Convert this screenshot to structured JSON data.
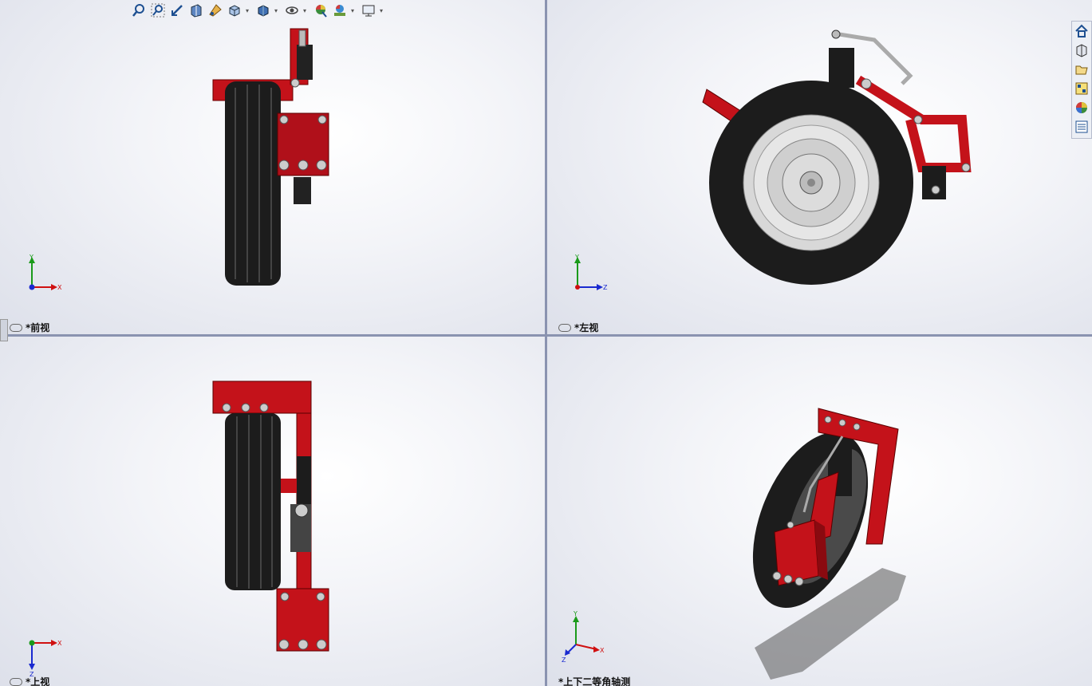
{
  "toolbar": {
    "items": [
      {
        "icon": "zoom-to-fit-icon",
        "dropdown": false
      },
      {
        "icon": "zoom-to-area-icon",
        "dropdown": false
      },
      {
        "icon": "previous-view-icon",
        "dropdown": false
      },
      {
        "icon": "section-view-icon",
        "dropdown": false
      },
      {
        "icon": "dynamic-annotation-icon",
        "dropdown": false
      },
      {
        "icon": "view-orientation-icon",
        "dropdown": true
      },
      {
        "icon": "display-style-icon",
        "dropdown": true
      },
      {
        "icon": "hide-show-items-icon",
        "dropdown": true
      },
      {
        "icon": "edit-appearance-icon",
        "dropdown": false
      },
      {
        "icon": "apply-scene-icon",
        "dropdown": true
      },
      {
        "icon": "view-settings-icon",
        "dropdown": true
      }
    ]
  },
  "task_pane": {
    "items": [
      "home-icon",
      "design-library-icon",
      "file-explorer-icon",
      "view-palette-icon",
      "appearances-icon",
      "custom-properties-icon"
    ]
  },
  "viewports": {
    "front": {
      "label": "*前视",
      "triad": {
        "up": "Y",
        "right": "X"
      }
    },
    "left": {
      "label": "*左视",
      "triad": {
        "up": "Y",
        "right": "Z"
      }
    },
    "top": {
      "label": "*上视",
      "triad": {
        "down": "Z",
        "right": "X"
      }
    },
    "iso": {
      "label": "*上下二等角轴测",
      "triad": {
        "up": "Y",
        "right": "X",
        "down": "Z"
      }
    }
  },
  "colors": {
    "part_red": "#c4121a",
    "tire_black": "#1c1c1c",
    "triad_green": "#1a9a1a",
    "triad_red": "#d01010",
    "triad_blue": "#1a2ad0",
    "divider": "#8a93b0"
  }
}
